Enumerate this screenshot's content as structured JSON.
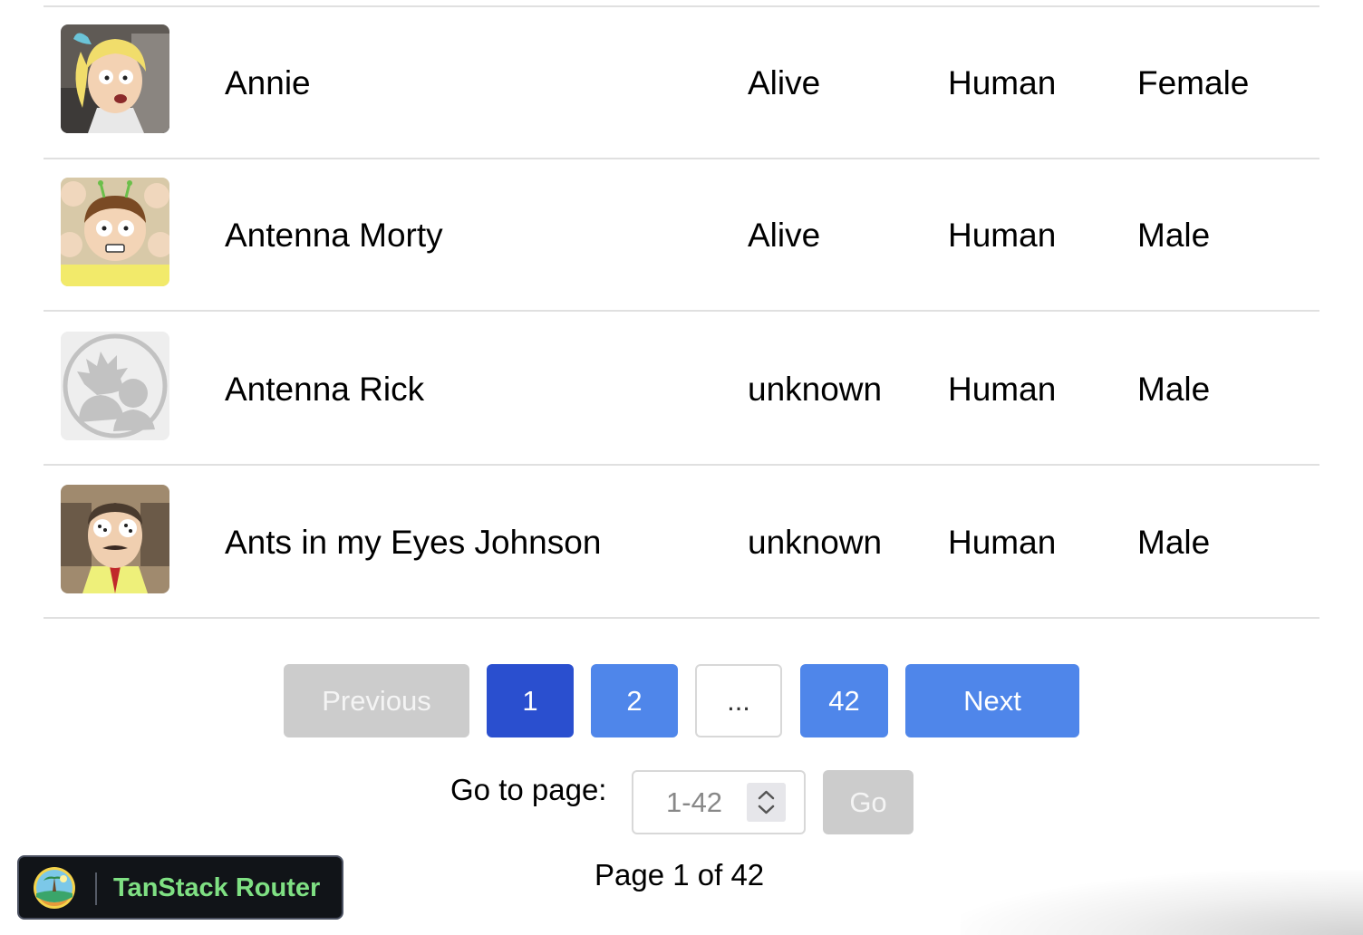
{
  "characters": [
    {
      "name": "Annie",
      "status": "Alive",
      "species": "Human",
      "gender": "Female",
      "avatar": "annie-avatar-icon"
    },
    {
      "name": "Antenna Morty",
      "status": "Alive",
      "species": "Human",
      "gender": "Male",
      "avatar": "antenna-morty-avatar-icon"
    },
    {
      "name": "Antenna Rick",
      "status": "unknown",
      "species": "Human",
      "gender": "Male",
      "avatar": "placeholder-avatar-icon"
    },
    {
      "name": "Ants in my Eyes Johnson",
      "status": "unknown",
      "species": "Human",
      "gender": "Male",
      "avatar": "ants-johnson-avatar-icon"
    }
  ],
  "pagination": {
    "previous_label": "Previous",
    "pages": [
      "1",
      "2",
      "...",
      "42"
    ],
    "current_page": "1",
    "next_label": "Next",
    "goto_label": "Go to page:",
    "goto_placeholder": "1-42",
    "go_label": "Go",
    "page_info": "Page 1 of 42"
  },
  "devtools": {
    "label": "TanStack Router",
    "logo": "tanstack-logo-icon",
    "label_color": "#7fe083"
  },
  "colors": {
    "active_page": "#2a4fcf",
    "page_button": "#4f86ea",
    "disabled_button": "#cccccc"
  }
}
